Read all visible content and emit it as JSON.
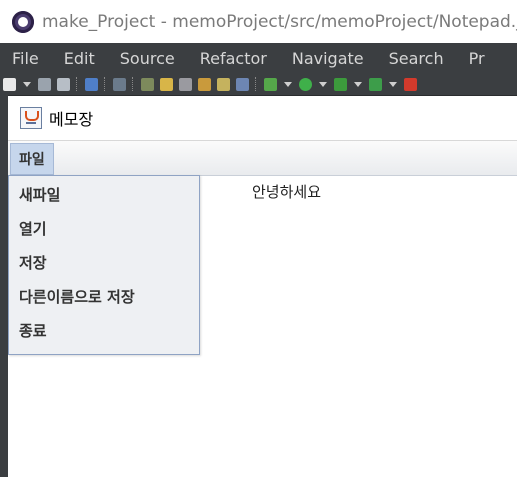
{
  "ide": {
    "title": "make_Project - memoProject/src/memoProject/Notepad.ja",
    "menu": [
      "File",
      "Edit",
      "Source",
      "Refactor",
      "Navigate",
      "Search",
      "Pr"
    ]
  },
  "app": {
    "title": "메모장",
    "menu_label": "파일",
    "menu_items": [
      "새파일",
      "열기",
      "저장",
      "다른이름으로 저장",
      "종료"
    ],
    "text_content": "안녕하세요"
  }
}
